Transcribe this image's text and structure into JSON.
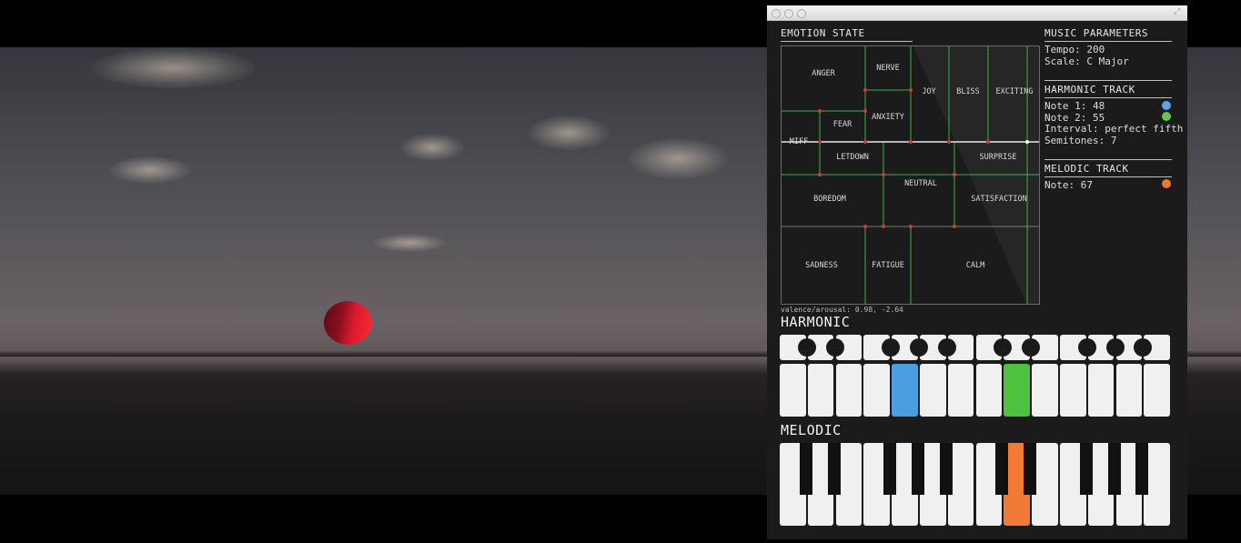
{
  "window": {
    "emotion_state_header": "EMOTION STATE",
    "valence_arousal": "valence/arousal: 0.98, -2.64"
  },
  "emotion_labels": {
    "anger": "ANGER",
    "nerve": "NERVE",
    "joy": "JOY",
    "bliss": "BLISS",
    "exciting": "EXCITING",
    "fear": "FEAR",
    "anxiety": "ANXIETY",
    "miff": "MIFF",
    "letdown": "LETDOWN",
    "surprise": "SURPRISE",
    "neutral": "NEUTRAL",
    "boredom": "BOREDOM",
    "satisfaction": "SATISFACTION",
    "sadness": "SADNESS",
    "fatigue": "FATIGUE",
    "calm": "CALM"
  },
  "music_parameters": {
    "header": "MUSIC PARAMETERS",
    "tempo": "Tempo: 200",
    "scale": "Scale: C Major"
  },
  "harmonic_track": {
    "header": "HARMONIC TRACK",
    "note1": "Note 1: 48",
    "note2": "Note 2: 55",
    "interval": "Interval: perfect fifth",
    "semitones": "Semitones: 7",
    "note1_color": "#5aa6e6",
    "note2_color": "#62c94a"
  },
  "melodic_track": {
    "header": "MELODIC TRACK",
    "note": "Note: 67",
    "note_color": "#f07432"
  },
  "keyboards": {
    "harmonic_label": "HARMONIC",
    "melodic_label": "MELODIC",
    "harmonic_active_keys": [
      4,
      8
    ],
    "melodic_active_key": 8
  },
  "colors": {
    "grid_line_green": "#3fae4a",
    "grid_node_red": "#d13a3a",
    "harmonic_blue": "#4a9fe0",
    "harmonic_green": "#4cc23e",
    "melodic_orange": "#f37a35"
  }
}
